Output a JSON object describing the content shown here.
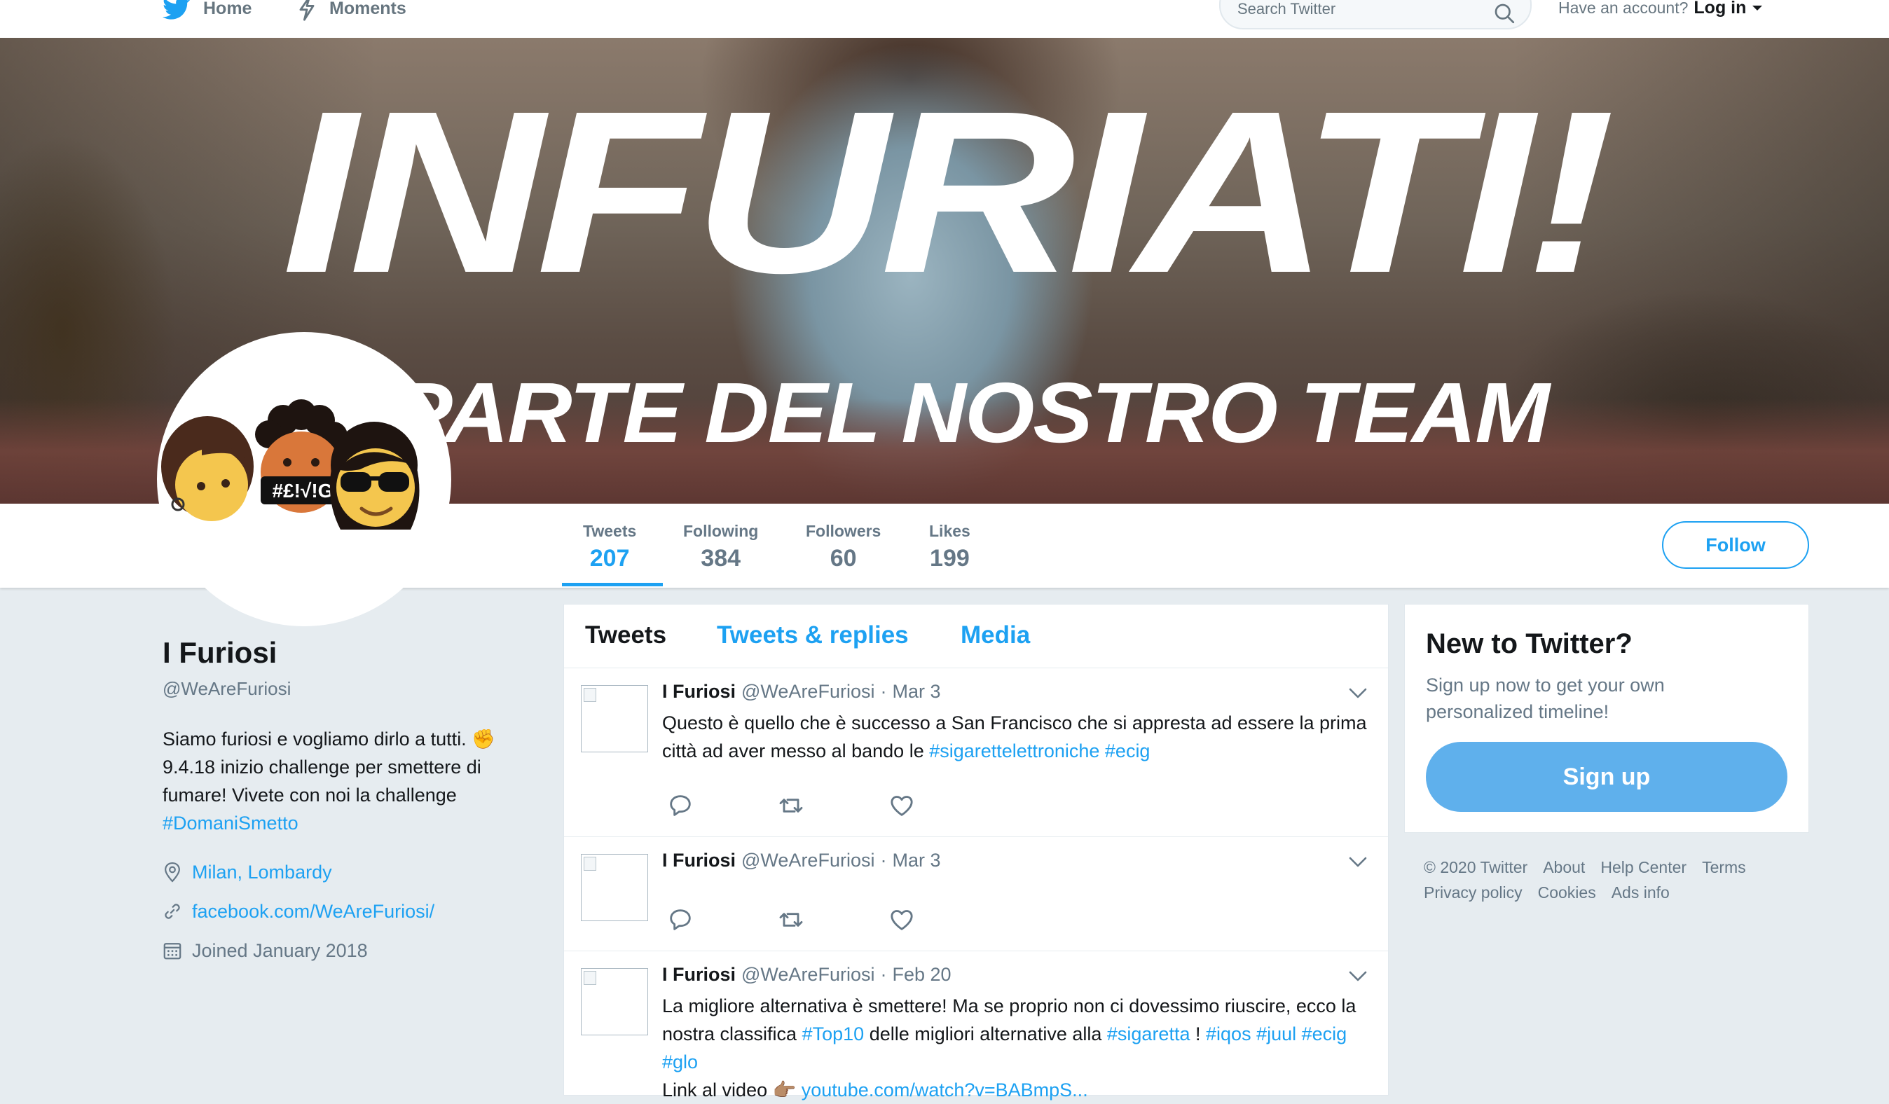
{
  "nav": {
    "home_label": "Home",
    "moments_label": "Moments",
    "search_placeholder": "Search Twitter",
    "account_prompt": "Have an account?",
    "login_label": "Log in"
  },
  "banner": {
    "title": "INFURIATI!",
    "subtitle": "PARTE DEL NOSTRO TEAM"
  },
  "profile": {
    "name": "I Furiosi",
    "handle": "@WeAreFuriosi",
    "bio": "Siamo furiosi e vogliamo dirlo a tutti. ✊ 9.4.18 inizio challenge per smettere di fumare! Vivete con noi la challenge",
    "bio_hashtag": "#DomaniSmetto",
    "location": "Milan, Lombardy",
    "website": "facebook.com/WeAreFuriosi/",
    "joined": "Joined January 2018",
    "avatar_text": "#£!√!G"
  },
  "stats": [
    {
      "label": "Tweets",
      "value": "207"
    },
    {
      "label": "Following",
      "value": "384"
    },
    {
      "label": "Followers",
      "value": "60"
    },
    {
      "label": "Likes",
      "value": "199"
    }
  ],
  "follow_label": "Follow",
  "timeline": {
    "tabs": [
      "Tweets",
      "Tweets & replies",
      "Media"
    ],
    "tweets": [
      {
        "name": "I Furiosi",
        "handle": "@WeAreFuriosi",
        "date": "Mar 3",
        "text_1": "Questo è quello che è successo a San Francisco che si appresta ad essere la prima città ad aver messo al bando le",
        "tag_1": "#sigarettelettroniche",
        "tag_2": "#ecig"
      },
      {
        "name": "I Furiosi",
        "handle": "@WeAreFuriosi",
        "date": "Mar 3"
      },
      {
        "name": "I Furiosi",
        "handle": "@WeAreFuriosi",
        "date": "Feb 20",
        "text_1": "La migliore alternativa è smettere! Ma se proprio non ci dovessimo riuscire, ecco la nostra classifica",
        "tag_1": "#Top10",
        "text_2": "delle migliori alternative alla",
        "tag_2": "#sigaretta",
        "text_3": "!",
        "tag_3": "#iqos",
        "tag_4": "#juul",
        "tag_5": "#ecig",
        "tag_6": "#glo",
        "text_4": "Link al video 👉🏽",
        "url": "youtube.com/watch?v=BABmpS..."
      }
    ]
  },
  "signup": {
    "title": "New to Twitter?",
    "text": "Sign up now to get your own personalized timeline!",
    "button": "Sign up"
  },
  "footer": {
    "copyright": "© 2020 Twitter",
    "about": "About",
    "help": "Help Center",
    "terms": "Terms",
    "privacy": "Privacy policy",
    "cookies": "Cookies",
    "ads": "Ads info"
  },
  "colors": {
    "accent": "#1da1f2",
    "signup_button": "#5fb0ec",
    "background": "#e6ecf0",
    "secondary_text": "#657786"
  },
  "icons": [
    "twitter-bird-icon",
    "lightning-icon",
    "search-icon",
    "caret-down-icon",
    "location-pin-icon",
    "link-icon",
    "calendar-icon",
    "reply-icon",
    "retweet-icon",
    "like-icon",
    "chevron-down-icon"
  ]
}
